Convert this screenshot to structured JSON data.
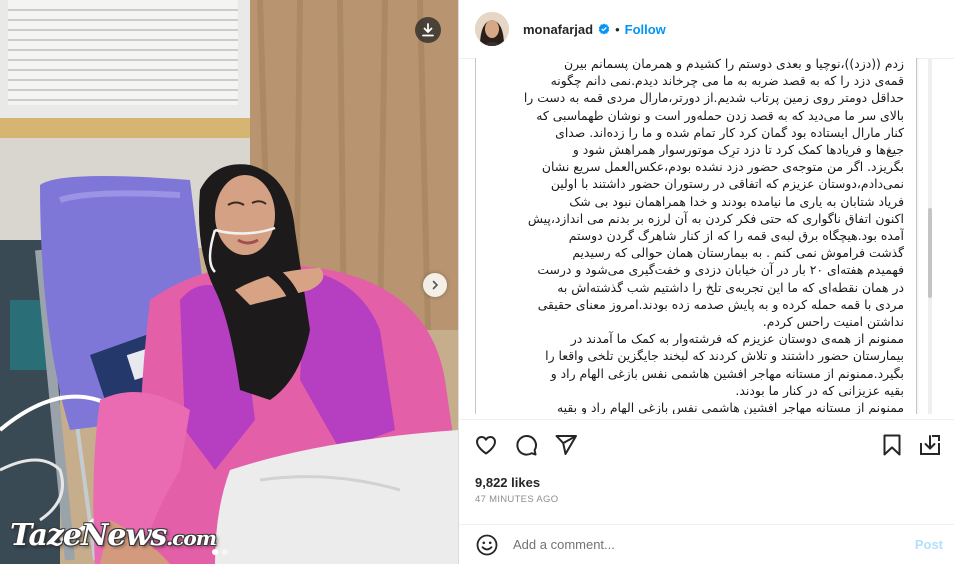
{
  "colors": {
    "accent": "#0095f6",
    "verified": "#0095f6",
    "post_disabled": "#b2dffc",
    "muted": "#8e8e8e"
  },
  "photo": {
    "watermark_main": "TazeNews",
    "watermark_suffix": ".com",
    "carousel": {
      "total": 2,
      "current": 1
    },
    "icons": {
      "download": "download-icon",
      "next": "chevron-right-icon"
    }
  },
  "header": {
    "username": "monafarjad",
    "separator": "•",
    "follow_label": "Follow"
  },
  "caption": {
    "lines": [
      "زدم ((دزد))،نوچیا و بعدی دوستم را کشیدم و همرمان پسمانم بیرن",
      "قمه‌ی دزد را که به قصد ضربه به ما می چرخاند دیدم.نمی دانم چگونه",
      "حداقل دومتر روی زمین پرتاب شدیم.از دورتر،مارال مردی قمه به دست را",
      "بالای سر ما می‌دید که به قصد زدن حمله‌ور است و نوشان طهماسبی که",
      "کنار مارال ایستاده بود گمان کرد کار تمام شده و ما را زده‌اند. صدای",
      "جیغ‌ها و فریادها کمک کرد تا دزد ترِک موتورسوار همراهش شود و",
      "بگریزد. اگر من متوجه‌ی حضور دزد نشده بودم،عکس‌العمل سریع نشان",
      "نمی‌دادم،دوستان عزیزم که اتفاقی در رستوران حضور داشتند با اولین",
      "فریاد شتابان به یاری ما نیامده بودند و خدا همراهمان نبود بی شک",
      "اکنون اتفاق ناگواری که حتی فکر کردن به آن لرزه بر بدنم می اندازد،پیش",
      "آمده بود.هیچگاه برق لبه‌ی قمه را که از کنار شاهرگ گردن دوستم",
      "گذشت فراموش نمی کنم . به بیمارستان همان حوالی که رسیدیم",
      "فهمیدم هفته‌ای ۲۰ بار در آن خیابان دزدی و خفت‌گیری می‌شود و درست",
      "در همان نقطه‌ای که ما این تجربه‌ی تلخ را داشتیم شب گذشته‌اش به",
      "مردی با قمه حمله کرده و به پایش صدمه زده بودند.امروز معنای حقیقی",
      "نداشتن امنیت راحس کردم.",
      "ممنونم از همه‌ی دوستان عزیزم که فرشته‌وار به کمک ما آمدند در",
      "بیمارستان حضور داشتند و تلاش کردند که لبخند جایگزین تلخی واقعا را",
      "بگیرد.ممنونم از مستانه مهاجر افشین هاشمی نفس بازغی الهام راد و",
      "بقیه عزیزانی که در کنار ما بودند.",
      "ممنونم از مستانه مهاجر افشین هاشمی نفس بازغی الهام راد و بقیه"
    ]
  },
  "actions": {
    "like": "heart-icon",
    "comment": "comment-icon",
    "share": "share-icon",
    "save": "bookmark-icon",
    "download": "download-icon"
  },
  "likes_text": "9,822 likes",
  "time_text": "47 MINUTES AGO",
  "comment_bar": {
    "placeholder": "Add a comment...",
    "post_label": "Post",
    "emoji_icon": "emoji-icon"
  }
}
